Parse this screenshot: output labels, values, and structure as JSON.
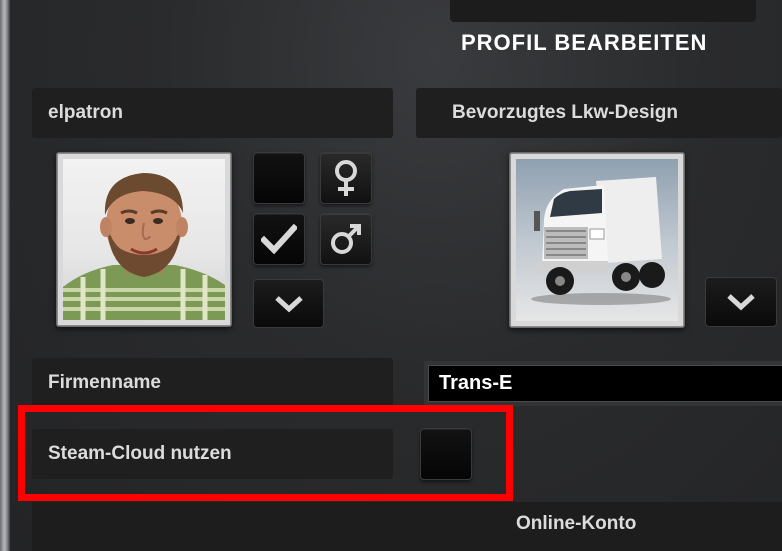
{
  "dialog": {
    "title": "PROFIL BEARBEITEN"
  },
  "profile": {
    "name": "elpatron",
    "avatar_icon": "profile-photo-bearded-man",
    "female_icon": "female-symbol",
    "male_icon": "male-symbol",
    "selected_gender": "male"
  },
  "truck": {
    "label": "Bevorzugtes Lkw-Design",
    "image_icon": "white-semi-truck"
  },
  "company": {
    "label": "Firmenname",
    "value": "Trans-E"
  },
  "steam_cloud": {
    "label": "Steam-Cloud nutzen",
    "checked": false,
    "highlight_color": "#ff0000"
  },
  "online": {
    "label": "Online-Konto"
  }
}
